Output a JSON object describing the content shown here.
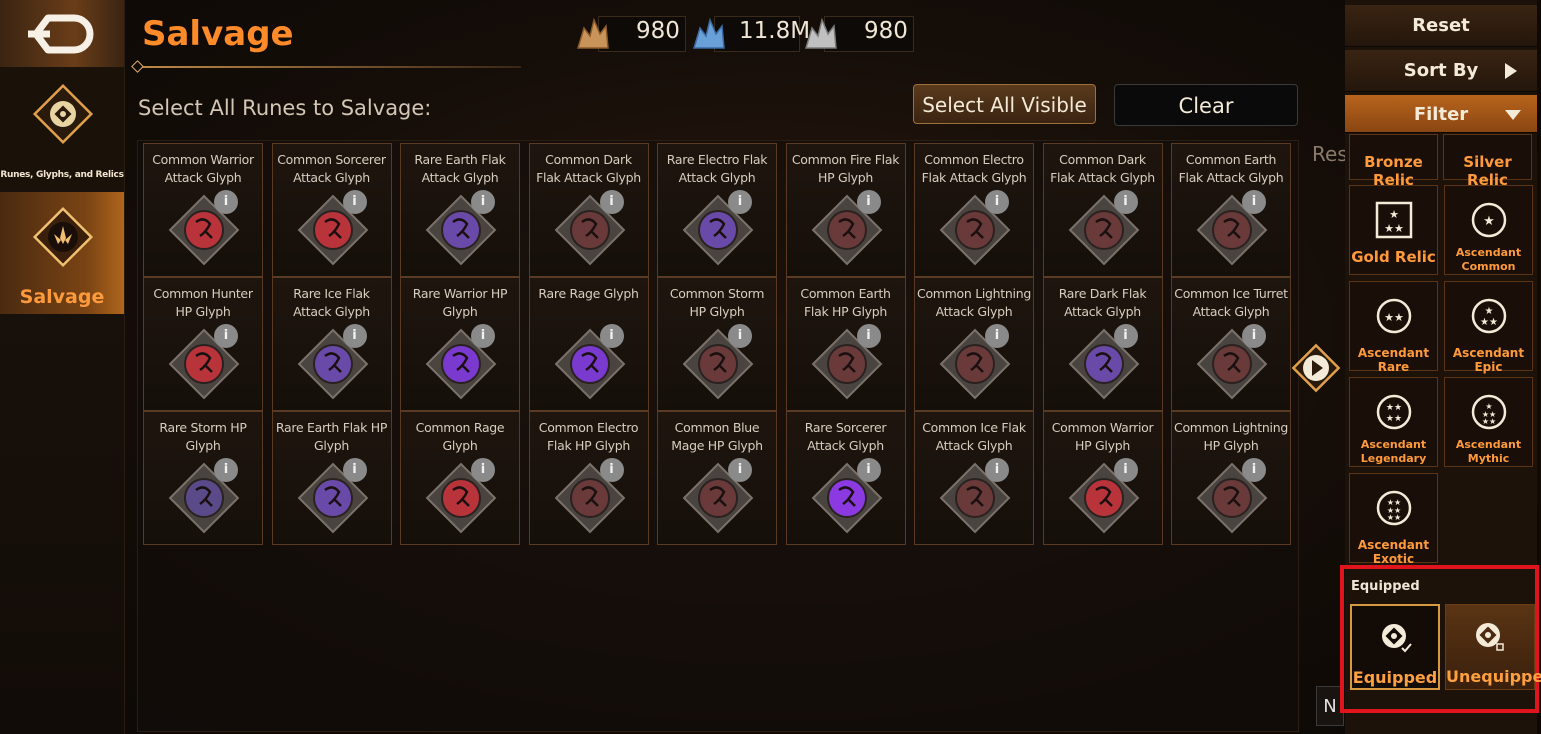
{
  "nav": {
    "items": [
      {
        "label": "Runes, Glyphs, and Relics"
      },
      {
        "label": "Salvage"
      }
    ]
  },
  "header": {
    "title": "Salvage",
    "currencies": [
      {
        "value": "980",
        "icon": "bronze-crystal-icon"
      },
      {
        "value": "11.8M",
        "icon": "blue-crystal-icon"
      },
      {
        "value": "980",
        "icon": "silver-crystal-icon"
      }
    ]
  },
  "main": {
    "subheading": "Select All Runes to Salvage:",
    "select_all_label": "Select All Visible",
    "clear_label": "Clear",
    "partial_text": "Res",
    "corner_text": "N",
    "info_glyph": "i",
    "cards": [
      {
        "name": "Common Warrior Attack Glyph",
        "color": "#b8343a"
      },
      {
        "name": "Common Sorcerer Attack Glyph",
        "color": "#b8343a"
      },
      {
        "name": "Rare Earth Flak Attack Glyph",
        "color": "#6a4aa8"
      },
      {
        "name": "Common Dark Flak Attack Glyph",
        "color": "#6a3a3a"
      },
      {
        "name": "Rare Electro Flak Attack Glyph",
        "color": "#6a4aa8"
      },
      {
        "name": "Common Fire Flak HP Glyph",
        "color": "#6a3a3a"
      },
      {
        "name": "Common Electro Flak Attack Glyph",
        "color": "#6a3a3a"
      },
      {
        "name": "Common Dark Flak Attack Glyph",
        "color": "#6a3a3a"
      },
      {
        "name": "Common Earth Flak Attack Glyph",
        "color": "#6a3a3a"
      },
      {
        "name": "Common Hunter HP Glyph",
        "color": "#b8343a"
      },
      {
        "name": "Rare Ice Flak Attack Glyph",
        "color": "#6a4aa8"
      },
      {
        "name": "Rare Warrior HP Glyph",
        "color": "#7a3ad0"
      },
      {
        "name": "Rare Rage Glyph",
        "color": "#7a3ad0"
      },
      {
        "name": "Common Storm HP Glyph",
        "color": "#6a3a3a"
      },
      {
        "name": "Common Earth Flak HP Glyph",
        "color": "#6a3a3a"
      },
      {
        "name": "Common Lightning Attack Glyph",
        "color": "#6a3a3a"
      },
      {
        "name": "Rare Dark Flak Attack Glyph",
        "color": "#6a4aa8"
      },
      {
        "name": "Common Ice Turret Attack Glyph",
        "color": "#6a3a3a"
      },
      {
        "name": "Rare Storm HP Glyph",
        "color": "#5a4a8a"
      },
      {
        "name": "Rare Earth Flak HP Glyph",
        "color": "#6a4aa8"
      },
      {
        "name": "Common Rage Glyph",
        "color": "#b8343a"
      },
      {
        "name": "Common Electro Flak HP Glyph",
        "color": "#6a3a3a"
      },
      {
        "name": "Common Blue Mage HP Glyph",
        "color": "#6a3a3a"
      },
      {
        "name": "Rare Sorcerer Attack Glyph",
        "color": "#8a3ae0"
      },
      {
        "name": "Common Ice Flak Attack Glyph",
        "color": "#6a3a3a"
      },
      {
        "name": "Common Warrior HP Glyph",
        "color": "#b8343a"
      },
      {
        "name": "Common Lightning HP Glyph",
        "color": "#6a3a3a"
      }
    ]
  },
  "right_panel": {
    "reset_label": "Reset",
    "sort_label": "Sort By",
    "filter_label": "Filter",
    "relic_filters": [
      {
        "label": "Bronze Relic"
      },
      {
        "label": "Silver Relic"
      },
      {
        "label": "Gold Relic"
      },
      {
        "label": "Ascendant Common"
      },
      {
        "label": "Ascendant Rare"
      },
      {
        "label": "Ascendant Epic"
      },
      {
        "label": "Ascendant Legendary"
      },
      {
        "label": "Ascendant Mythic"
      },
      {
        "label": "Ascendant Exotic"
      }
    ],
    "equipped_section": {
      "title": "Equipped",
      "options": [
        {
          "label": "Equipped",
          "selected": true
        },
        {
          "label": "Unequipped",
          "selected": false
        }
      ]
    }
  },
  "colors": {
    "accent": "#ff8a2a",
    "highlight_box": "#e0141c"
  }
}
